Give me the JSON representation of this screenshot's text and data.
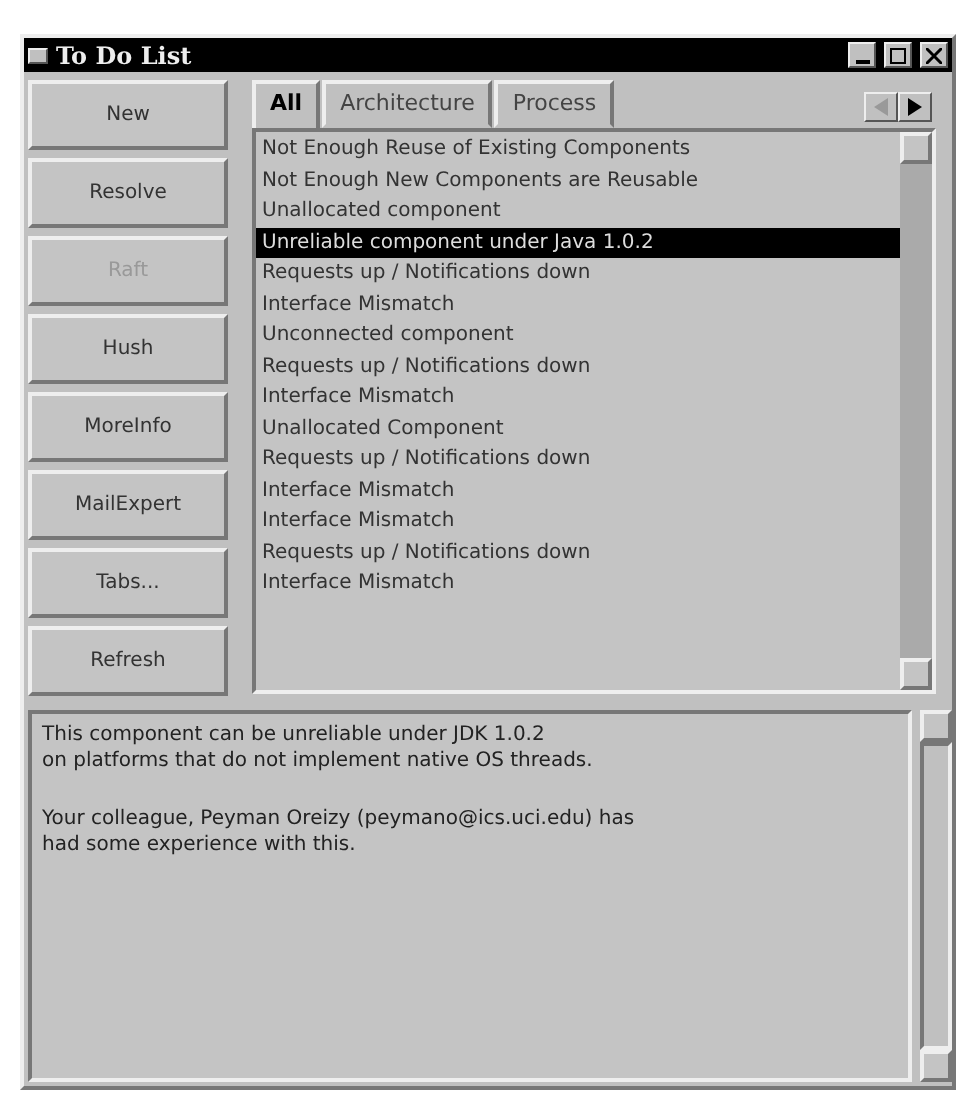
{
  "window": {
    "title": "To Do List"
  },
  "buttons": [
    {
      "label": "New",
      "disabled": false
    },
    {
      "label": "Resolve",
      "disabled": false
    },
    {
      "label": "Raft",
      "disabled": true
    },
    {
      "label": "Hush",
      "disabled": false
    },
    {
      "label": "MoreInfo",
      "disabled": false
    },
    {
      "label": "MailExpert",
      "disabled": false
    },
    {
      "label": "Tabs...",
      "disabled": false
    },
    {
      "label": "Refresh",
      "disabled": false
    }
  ],
  "tabs": [
    {
      "label": "All",
      "selected": true
    },
    {
      "label": "Architecture",
      "selected": false
    },
    {
      "label": "Process",
      "selected": false
    }
  ],
  "items": [
    {
      "text": "Not Enough Reuse of Existing Components",
      "selected": false
    },
    {
      "text": "Not Enough New Components are Reusable",
      "selected": false
    },
    {
      "text": "Unallocated component",
      "selected": false
    },
    {
      "text": "Unreliable component under Java 1.0.2",
      "selected": true
    },
    {
      "text": "Requests up / Notifications down",
      "selected": false
    },
    {
      "text": "Interface Mismatch",
      "selected": false
    },
    {
      "text": "Unconnected component",
      "selected": false
    },
    {
      "text": "Requests up / Notifications down",
      "selected": false
    },
    {
      "text": "Interface Mismatch",
      "selected": false
    },
    {
      "text": "Unallocated Component",
      "selected": false
    },
    {
      "text": "Requests up / Notifications down",
      "selected": false
    },
    {
      "text": "Interface Mismatch",
      "selected": false
    },
    {
      "text": "Interface Mismatch",
      "selected": false
    },
    {
      "text": "Requests up / Notifications down",
      "selected": false
    },
    {
      "text": "Interface Mismatch",
      "selected": false
    }
  ],
  "details": [
    {
      "lines": [
        "This component can be unreliable under JDK 1.0.2",
        "on platforms that do not implement native OS threads."
      ]
    },
    {
      "lines": [
        "Your colleague, Peyman Oreizy (peymano@ics.uci.edu) has",
        "had some experience with this."
      ]
    }
  ]
}
